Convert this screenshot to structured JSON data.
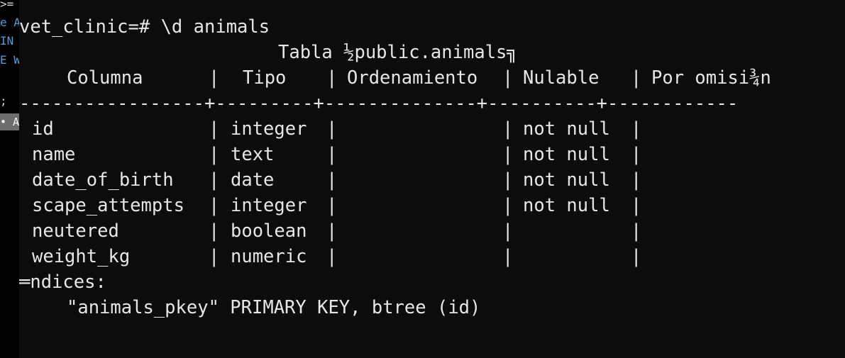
{
  "left_editor": {
    "lines": [
      {
        "text": ">=",
        "color": "#d4d4d4"
      },
      {
        "text": "e A",
        "color": "#569cd6"
      },
      {
        "text": "IN",
        "color": "#569cd6"
      },
      {
        "text": "E W",
        "color": "#569cd6"
      },
      {
        "text": ";",
        "color": "#d4d4d4"
      }
    ],
    "badge": "• AN"
  },
  "terminal": {
    "prompt": "vet_clinic=# \\d animals",
    "table_title": "Tabla ½public.animals╗",
    "headers": [
      "Columna",
      "Tipo",
      "Ordenamiento",
      "Nulable",
      "Por omisi¾n"
    ],
    "separator": "-----------------+---------+--------------+----------+------------",
    "rows": [
      {
        "columna": "id",
        "tipo": "integer",
        "ordenamiento": "",
        "nulable": "not null",
        "por_omision": ""
      },
      {
        "columna": "name",
        "tipo": "text",
        "ordenamiento": "",
        "nulable": "not null",
        "por_omision": ""
      },
      {
        "columna": "date_of_birth",
        "tipo": "date",
        "ordenamiento": "",
        "nulable": "not null",
        "por_omision": ""
      },
      {
        "columna": "scape_attempts",
        "tipo": "integer",
        "ordenamiento": "",
        "nulable": "not null",
        "por_omision": ""
      },
      {
        "columna": "neutered",
        "tipo": "boolean",
        "ordenamiento": "",
        "nulable": "",
        "por_omision": ""
      },
      {
        "columna": "weight_kg",
        "tipo": "numeric",
        "ordenamiento": "",
        "nulable": "",
        "por_omision": ""
      }
    ],
    "indices_label": "═ndices:",
    "index_entry": "\"animals_pkey\" PRIMARY KEY, btree (id)"
  }
}
